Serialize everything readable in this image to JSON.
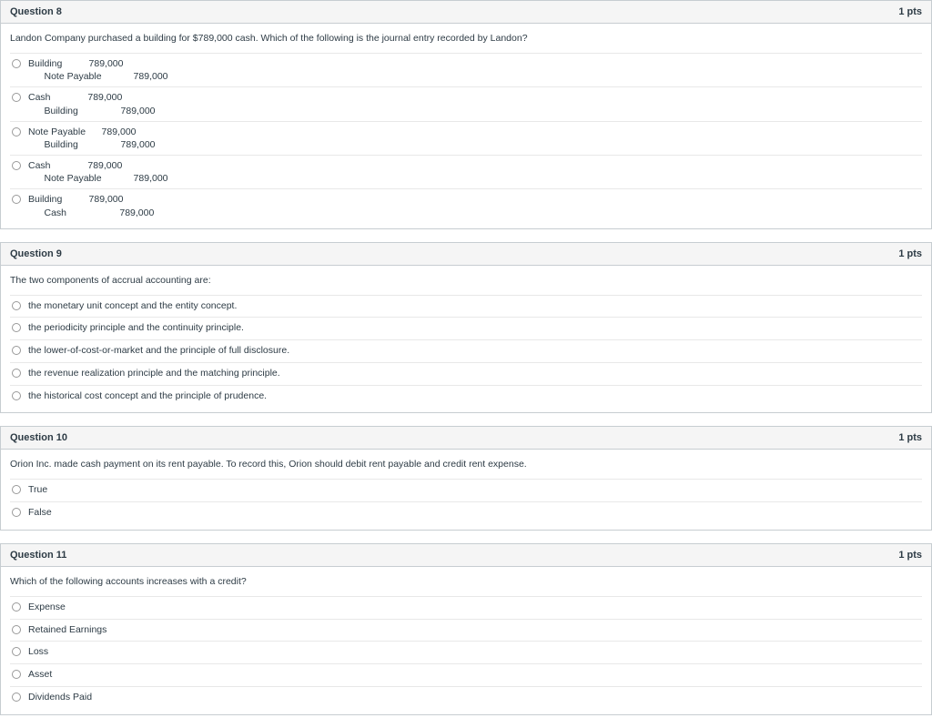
{
  "questions": [
    {
      "number": "Question 8",
      "points": "1 pts",
      "prompt": "Landon Company purchased a building for $789,000 cash. Which of the following is the journal entry recorded by Landon?",
      "type": "journal",
      "options": [
        {
          "debit_account": "Building",
          "debit_amount": "789,000",
          "credit_account": "Note Payable",
          "credit_amount": "789,000"
        },
        {
          "debit_account": "Cash",
          "debit_amount": "789,000",
          "credit_account": "Building",
          "credit_amount": "789,000"
        },
        {
          "debit_account": "Note Payable",
          "debit_amount": "789,000",
          "credit_account": "Building",
          "credit_amount": "789,000"
        },
        {
          "debit_account": "Cash",
          "debit_amount": "789,000",
          "credit_account": "Note Payable",
          "credit_amount": "789,000"
        },
        {
          "debit_account": "Building",
          "debit_amount": "789,000",
          "credit_account": "Cash",
          "credit_amount": "789,000"
        }
      ]
    },
    {
      "number": "Question 9",
      "points": "1 pts",
      "prompt": "The two components of accrual accounting are:",
      "type": "text",
      "options": [
        "the monetary unit concept and the entity concept.",
        "the periodicity principle and the continuity principle.",
        "the lower-of-cost-or-market and the principle of full disclosure.",
        "the revenue realization principle and the matching principle.",
        "the historical cost concept and the principle of prudence."
      ]
    },
    {
      "number": "Question 10",
      "points": "1 pts",
      "prompt": "Orion Inc. made cash payment on its rent payable. To record this, Orion should debit rent payable and credit rent expense.",
      "type": "text",
      "options": [
        "True",
        "False"
      ]
    },
    {
      "number": "Question 11",
      "points": "1 pts",
      "prompt": "Which of the following accounts increases with a credit?",
      "type": "text",
      "options": [
        "Expense",
        "Retained Earnings",
        "Loss",
        "Asset",
        "Dividends Paid"
      ]
    }
  ]
}
